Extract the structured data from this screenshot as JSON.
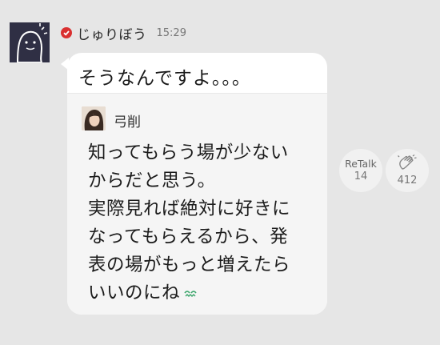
{
  "post": {
    "sender_name": "じゅりぼう",
    "time": "15:29",
    "message": "そうなんですよ。。。"
  },
  "quote": {
    "author": "弓削",
    "lines": [
      "知ってもらう場が少ない",
      "からだと思う。",
      "実際見れば絶対に好きに",
      "なってもらえるから、発",
      "表の場がもっと増えたら",
      "いいのにね"
    ]
  },
  "actions": {
    "retalk_label": "ReTalk",
    "retalk_count": "14",
    "clap_count": "412"
  },
  "icons": {
    "verified": "verified-check-icon",
    "retalk": "retalk-icon",
    "clap": "clap-icon",
    "emoji": "sweat-emoji-icon"
  },
  "colors": {
    "background": "#e6e6e6",
    "verified": "#d93030",
    "avatar_bg": "#2f2f44"
  }
}
